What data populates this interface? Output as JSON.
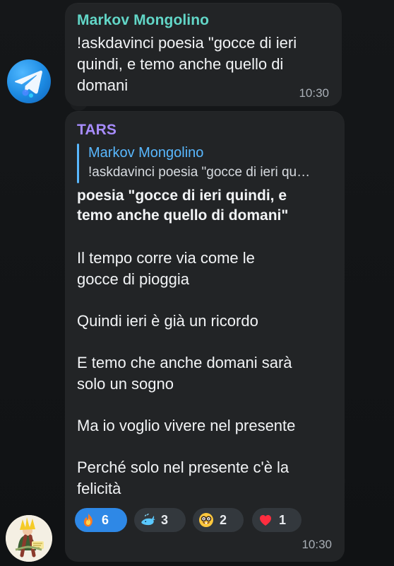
{
  "messages": [
    {
      "sender": "Markov Mongolino",
      "text": "!askdavinci poesia \"gocce di ieri\nquindi, e temo anche quello di\ndomani",
      "time": "10:30"
    },
    {
      "sender": "TARS",
      "reply_to": {
        "sender": "Markov Mongolino",
        "text": "!askdavinci poesia \"gocce di ieri qu…"
      },
      "title": "poesia \"gocce di ieri quindi, e\ntemo anche quello di domani\"",
      "lines": [
        "Il tempo corre via come le\ngocce di pioggia",
        "Quindi ieri è già un ricordo",
        "E temo che anche domani sarà\nsolo un sogno",
        "Ma io voglio vivere nel presente",
        "Perché solo nel presente c'è la\nfelicità"
      ],
      "time": "10:30",
      "reactions": [
        {
          "emoji": "fire-emoji",
          "count": "6",
          "active": true
        },
        {
          "emoji": "whale-emoji",
          "count": "3",
          "active": false
        },
        {
          "emoji": "nerd-face-emoji",
          "count": "2",
          "active": false
        },
        {
          "emoji": "heart-emoji",
          "count": "1",
          "active": false
        }
      ]
    }
  ]
}
